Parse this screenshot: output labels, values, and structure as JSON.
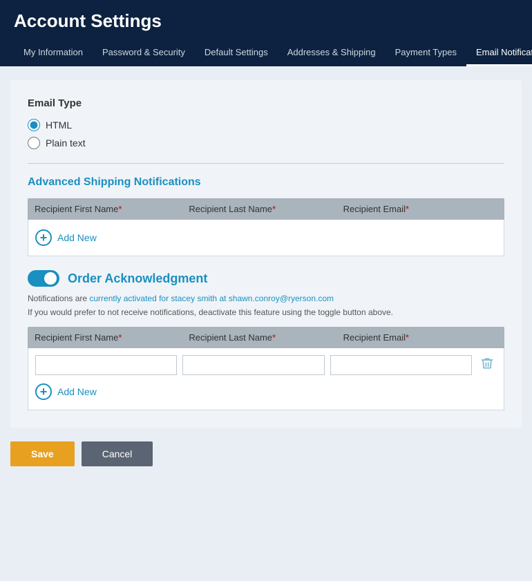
{
  "header": {
    "title": "Account Settings",
    "nav": [
      {
        "label": "My Information",
        "active": false
      },
      {
        "label": "Password & Security",
        "active": false
      },
      {
        "label": "Default Settings",
        "active": false
      },
      {
        "label": "Addresses & Shipping",
        "active": false
      },
      {
        "label": "Payment Types",
        "active": false
      },
      {
        "label": "Email Notifications",
        "active": true
      }
    ]
  },
  "email_type": {
    "section_title": "Email Type",
    "options": [
      {
        "label": "HTML",
        "checked": true
      },
      {
        "label": "Plain text",
        "checked": false
      }
    ]
  },
  "advanced_shipping": {
    "section_title": "Advanced Shipping Notifications",
    "columns": [
      {
        "label": "Recipient First Name",
        "required": true
      },
      {
        "label": "Recipient Last Name",
        "required": true
      },
      {
        "label": "Recipient Email",
        "required": true
      }
    ],
    "add_new_label": "Add New"
  },
  "order_acknowledgment": {
    "toggle_label": "Order Acknowledgment",
    "toggle_on": true,
    "notification_text_1": "Notifications are ",
    "notification_highlight": "currently activated for stacey smith at shawn.conroy@ryerson.com",
    "notification_text_2": "If you would prefer to not receive notifications, deactivate this feature using the toggle button above.",
    "columns": [
      {
        "label": "Recipient First Name",
        "required": true
      },
      {
        "label": "Recipient Last Name",
        "required": true
      },
      {
        "label": "Recipient Email",
        "required": true
      }
    ],
    "add_new_label": "Add New"
  },
  "buttons": {
    "save": "Save",
    "cancel": "Cancel"
  }
}
